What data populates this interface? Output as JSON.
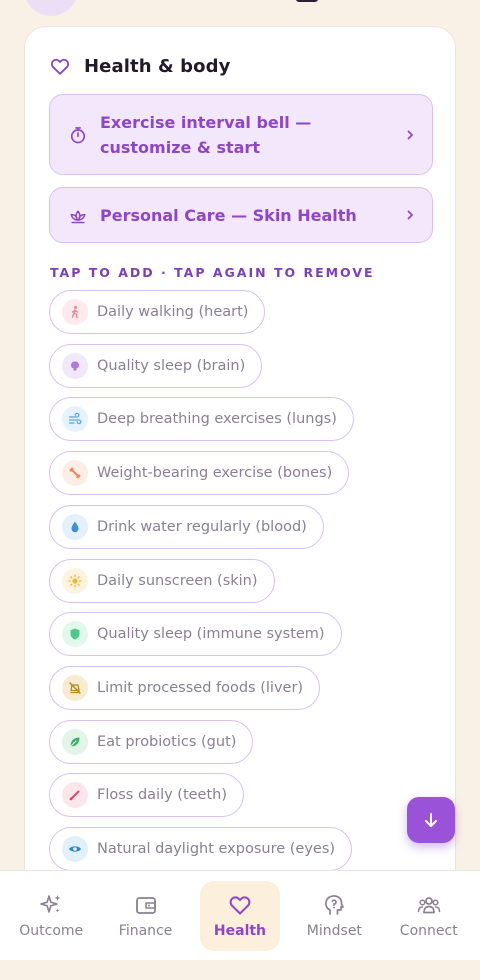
{
  "section": {
    "title": "Health & body",
    "icon": "heart-icon"
  },
  "features": [
    {
      "label": "Exercise interval bell — customize & start",
      "icon": "stopwatch-icon"
    },
    {
      "label": "Personal Care — Skin Health",
      "icon": "lotus-icon"
    }
  ],
  "hint": "TAP TO ADD · TAP AGAIN TO REMOVE",
  "chips": [
    {
      "label": "Daily walking (heart)",
      "icon": "walking-icon",
      "color": "#e8849a",
      "bg": "#fde9ee"
    },
    {
      "label": "Quality sleep (brain)",
      "icon": "brain-icon",
      "color": "#b07ad8",
      "bg": "#f2e8fb"
    },
    {
      "label": "Deep breathing exercises (lungs)",
      "icon": "wind-icon",
      "color": "#5aa6dc",
      "bg": "#e6f3fc"
    },
    {
      "label": "Weight-bearing exercise (bones)",
      "icon": "bone-icon",
      "color": "#e8895e",
      "bg": "#fdeee5"
    },
    {
      "label": "Drink water regularly (blood)",
      "icon": "droplet-icon",
      "color": "#3e8fd8",
      "bg": "#e4f0fb"
    },
    {
      "label": "Daily sunscreen (skin)",
      "icon": "sun-icon",
      "color": "#f0b33c",
      "bg": "#fdf4e0"
    },
    {
      "label": "Quality sleep (immune system)",
      "icon": "shield-icon",
      "color": "#4fc98a",
      "bg": "#e3f8ec"
    },
    {
      "label": "Limit processed foods (liver)",
      "icon": "no-food-icon",
      "color": "#b58a1e",
      "bg": "#f7eccf"
    },
    {
      "label": "Eat probiotics (gut)",
      "icon": "leaf-icon",
      "color": "#3fae6a",
      "bg": "#e2f5e9"
    },
    {
      "label": "Floss daily (teeth)",
      "icon": "floss-icon",
      "color": "#d84a6a",
      "bg": "#fce6ec"
    },
    {
      "label": "Natural daylight exposure (eyes)",
      "icon": "eye-icon",
      "color": "#2e86c9",
      "bg": "#e2f0fb"
    }
  ],
  "fab": {
    "icon": "arrow-down-icon"
  },
  "nav": [
    {
      "label": "Outcome",
      "icon": "sparkles-icon",
      "active": false
    },
    {
      "label": "Finance",
      "icon": "wallet-icon",
      "active": false
    },
    {
      "label": "Health",
      "icon": "heart-icon",
      "active": true
    },
    {
      "label": "Mindset",
      "icon": "head-question-icon",
      "active": false
    },
    {
      "label": "Connect",
      "icon": "people-icon",
      "active": false
    }
  ],
  "colors": {
    "accent": "#8e46c5",
    "background": "#faf1e6",
    "chip_border": "#d8c0ef"
  }
}
